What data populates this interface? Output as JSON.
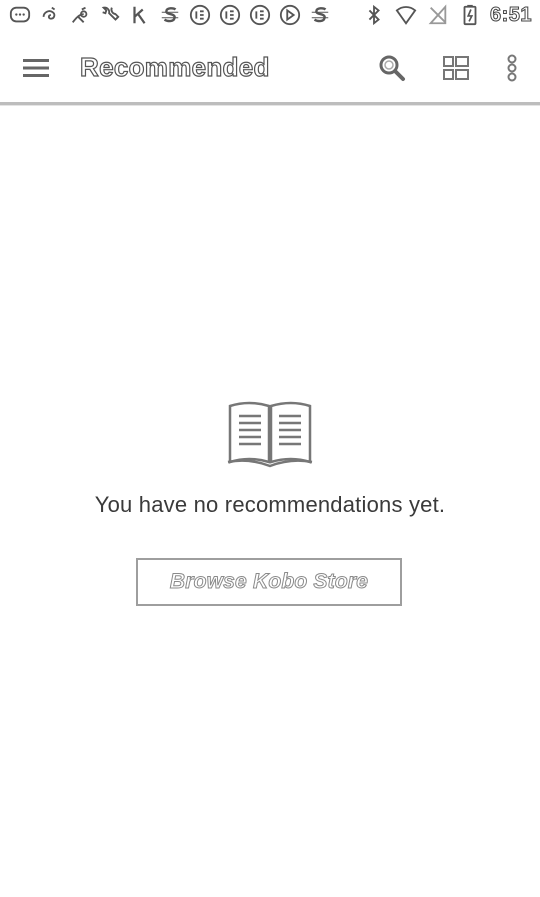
{
  "status_bar": {
    "time": "6:51",
    "left_icons": [
      "chat-icon",
      "swirl-icon",
      "branch-icon",
      "wrench-icon",
      "kobo-k-icon",
      "s-logo-icon",
      "badge-icon",
      "badge-icon",
      "badge-icon",
      "play-icon",
      "s-logo-icon"
    ],
    "right_icons": [
      "bluetooth-icon",
      "wifi-icon",
      "no-signal-icon",
      "battery-icon"
    ]
  },
  "toolbar": {
    "title": "Recommended",
    "menu_icon": "hamburger-menu-icon",
    "actions": [
      "search-icon",
      "view-toggle-icon",
      "overflow-menu-icon"
    ]
  },
  "empty_state": {
    "icon": "open-book-icon",
    "message": "You have no recommendations yet.",
    "button_label": "Browse Kobo Store"
  },
  "colors": {
    "background": "#ffffff",
    "text": "#3a3a3a",
    "divider": "#bdbdbd",
    "button_border": "#9e9e9e"
  }
}
